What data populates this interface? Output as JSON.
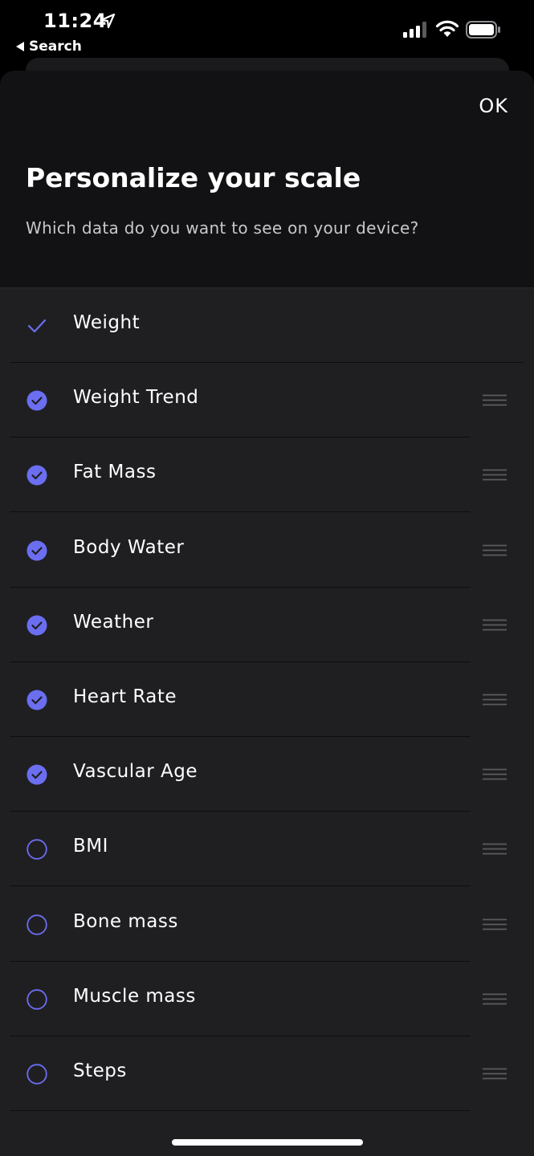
{
  "status_bar": {
    "time": "11:24",
    "back_label": "Search"
  },
  "sheet": {
    "ok_label": "OK",
    "title": "Personalize your scale",
    "subtitle": "Which data do you want to see on your device?"
  },
  "colors": {
    "accent": "#6b6ef0",
    "sheet_bg": "#121214",
    "list_bg": "#1f1f22"
  },
  "items": [
    {
      "label": "Weight",
      "state": "locked",
      "icon": "checkmark-icon"
    },
    {
      "label": "Weight Trend",
      "state": "checked",
      "icon": "checked-circle-icon"
    },
    {
      "label": "Fat Mass",
      "state": "checked",
      "icon": "checked-circle-icon"
    },
    {
      "label": "Body Water",
      "state": "checked",
      "icon": "checked-circle-icon"
    },
    {
      "label": "Weather",
      "state": "checked",
      "icon": "checked-circle-icon"
    },
    {
      "label": "Heart Rate",
      "state": "checked",
      "icon": "checked-circle-icon"
    },
    {
      "label": "Vascular Age",
      "state": "checked",
      "icon": "checked-circle-icon"
    },
    {
      "label": "BMI",
      "state": "unchecked",
      "icon": "empty-circle-icon"
    },
    {
      "label": "Bone mass",
      "state": "unchecked",
      "icon": "empty-circle-icon"
    },
    {
      "label": "Muscle mass",
      "state": "unchecked",
      "icon": "empty-circle-icon"
    },
    {
      "label": "Steps",
      "state": "unchecked",
      "icon": "empty-circle-icon"
    }
  ]
}
